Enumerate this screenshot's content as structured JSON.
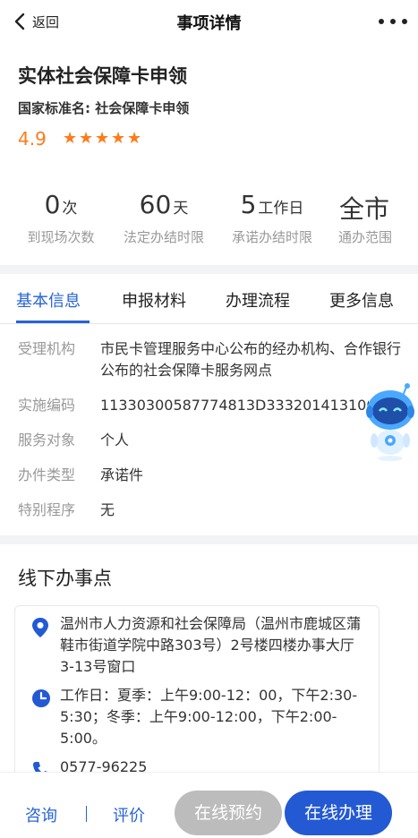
{
  "navbar": {
    "back_label": "返回",
    "title": "事项详情"
  },
  "item": {
    "title": "实体社会保障卡申领",
    "standard_name": "国家标准名: 社会保障卡申领",
    "rating": "4.9",
    "rating_stars": 5
  },
  "stats": [
    {
      "value": "0",
      "unit": "次",
      "label": "到现场次数"
    },
    {
      "value": "60",
      "unit": "天",
      "label": "法定办结时限"
    },
    {
      "value": "5",
      "unit": "工作日",
      "label": "承诺办结时限"
    },
    {
      "value": "全市",
      "unit": "",
      "label": "通办范围"
    }
  ],
  "tabs": [
    "基本信息",
    "申报材料",
    "办理流程",
    "更多信息"
  ],
  "active_tab": "基本信息",
  "basic_info": [
    {
      "label": "受理机构",
      "value": "市民卡管理服务中心公布的经办机构、合作银行公布的社会保障卡服务网点"
    },
    {
      "label": "实施编码",
      "value": "11330300587774813D3332014131005"
    },
    {
      "label": "服务对象",
      "value": "个人"
    },
    {
      "label": "办件类型",
      "value": "承诺件"
    },
    {
      "label": "特别程序",
      "value": "无"
    }
  ],
  "offline": {
    "title": "线下办事点",
    "address": "温州市人力资源和社会保障局（温州市鹿城区蒲鞋市街道学院中路303号）2号楼四楼办事大厅3-13号窗口",
    "hours": "工作日：夏季：上午9:00-12：00，下午2:30-5:30；冬季：上午9:00-12:00，下午2:00-5:00。",
    "phone": "0577-96225"
  },
  "bottom": {
    "consult": "咨询",
    "evaluate": "评价",
    "reserve": "在线预约",
    "handle": "在线办理"
  },
  "colors": {
    "accent": "#2764d3",
    "rating": "#ff7a1a",
    "button_disabled": "#bcbcbc"
  },
  "icons": [
    "chevron-left-icon",
    "more-icon",
    "star-icon",
    "location-pin-icon",
    "clock-icon",
    "phone-icon",
    "robot-assistant-icon"
  ]
}
